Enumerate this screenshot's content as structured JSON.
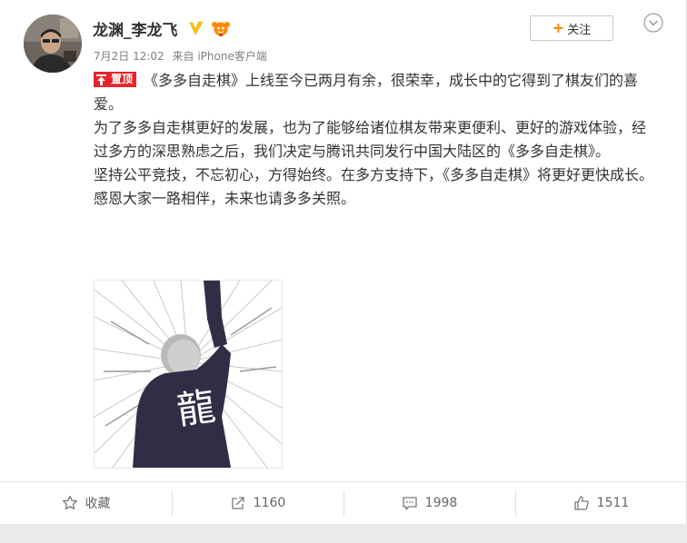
{
  "user": {
    "name": "龙渊_李龙飞",
    "meta_date": "7月2日 12:02",
    "meta_source": "来自 iPhone客户端",
    "follow_label": "关注",
    "follow_plus": "+"
  },
  "post": {
    "pin_label": "置顶",
    "paragraphs": [
      "《多多自走棋》上线至今已两月有余，很荣幸，成长中的它得到了棋友们的喜爱。",
      "为了多多自走棋更好的发展，也为了能够给诸位棋友带来更便利、更好的游戏体验，经过多方的深思熟虑之后，我们决定与腾讯共同发行中国大陆区的《多多自走棋》。",
      "坚持公平竞技，不忘初心，方得始终。在多方支持下，《多多自走棋》将更好更快成长。",
      "感恩大家一路相伴，未来也请多多关照。"
    ],
    "image_text": "龍"
  },
  "actions": {
    "favorite_label": "收藏",
    "repost_count": "1160",
    "comment_count": "1998",
    "like_count": "1511"
  },
  "colors": {
    "accent_orange": "#ff8200",
    "pin_red": "#e5252b",
    "verified_yellow": "#ffc300",
    "shirt_navy": "#2f2e45"
  },
  "icons": [
    "verified-icon",
    "vip-icon",
    "chevron-down-icon",
    "pin-icon",
    "star-icon",
    "repost-icon",
    "comment-icon",
    "like-icon"
  ]
}
